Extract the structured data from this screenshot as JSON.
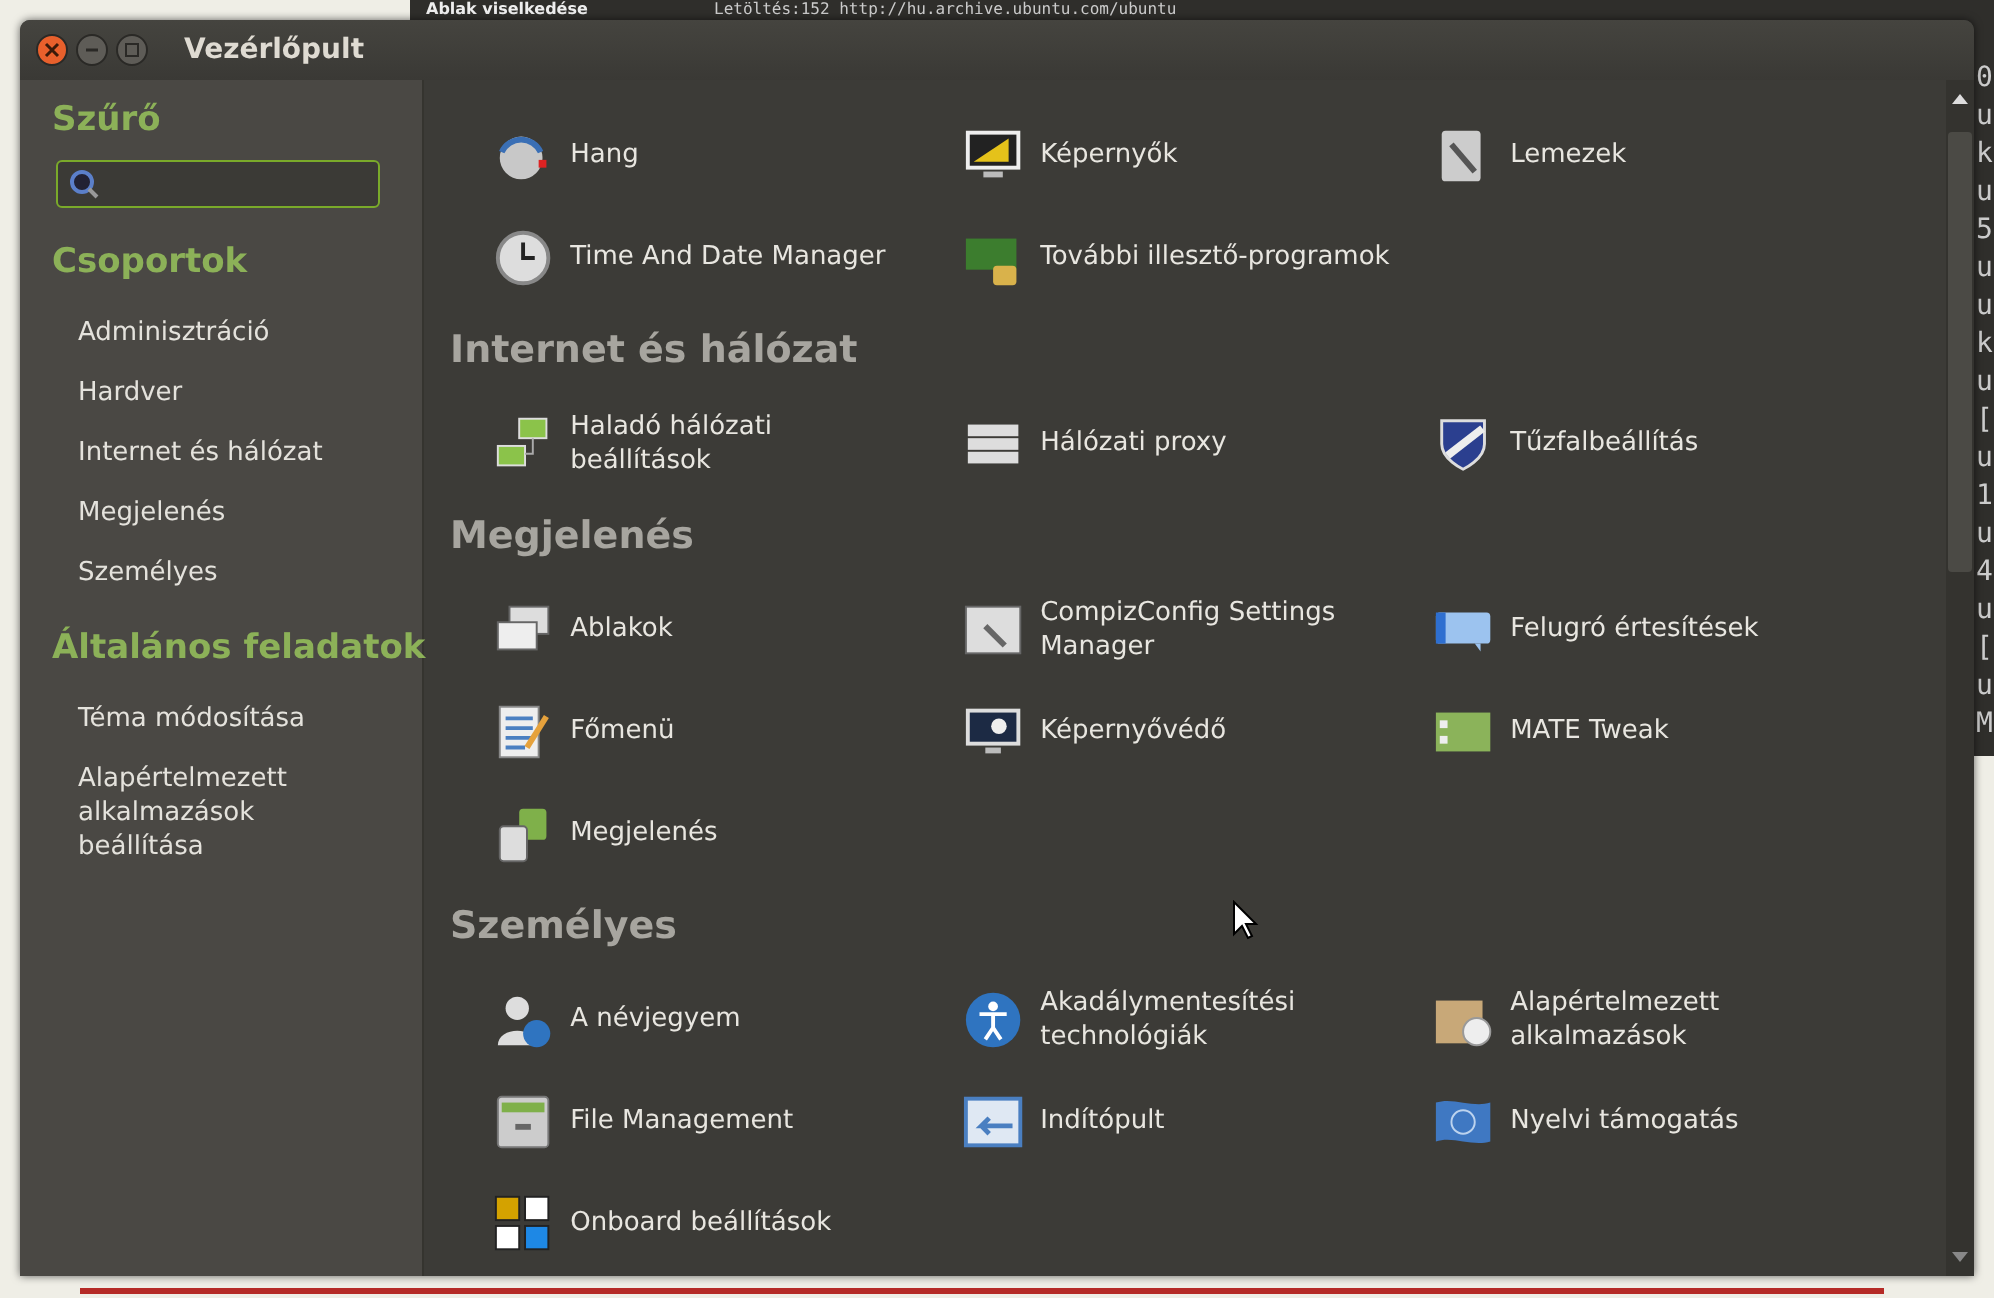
{
  "background": {
    "window_title": "Ablak viselkedése",
    "terminal_first_line": "Letöltés:152 http://hu.archive.ubuntu.com/ubuntu",
    "terminal_column": [
      "0",
      "u",
      "k",
      "u",
      "5",
      "u",
      "u",
      "k",
      "u",
      "[",
      "u",
      "1",
      "u",
      "4",
      "u",
      "[",
      "u",
      "M"
    ]
  },
  "window": {
    "title": "Vezérlőpult"
  },
  "sidebar": {
    "filter_heading": "Szűrő",
    "groups_heading": "Csoportok",
    "groups": [
      "Adminisztráció",
      "Hardver",
      "Internet és hálózat",
      "Megjelenés",
      "Személyes"
    ],
    "tasks_heading": "Általános feladatok",
    "tasks": [
      "Téma módosítása",
      "Alapértelmezett alkalmazások beállítása"
    ]
  },
  "sections": [
    {
      "items": [
        "Hang",
        "Képernyők",
        "Lemezek",
        "Time And Date Manager",
        "További illesztő-programok"
      ]
    },
    {
      "title": "Internet és hálózat",
      "items": [
        "Haladó hálózati beállítások",
        "Hálózati proxy",
        "Tűzfalbeállítás"
      ]
    },
    {
      "title": "Megjelenés",
      "items": [
        "Ablakok",
        "CompizConfig Settings Manager",
        "Felugró értesítések",
        "Főmenü",
        "Képernyővédő",
        "MATE Tweak",
        "Megjelenés"
      ]
    },
    {
      "title": "Személyes",
      "items": [
        "A névjegyem",
        "Akadálymentesítési technológiák",
        "Alapértelmezett alkalmazások",
        "File Management",
        "Indítópult",
        "Nyelvi támogatás",
        "Onboard beállítások"
      ]
    }
  ]
}
